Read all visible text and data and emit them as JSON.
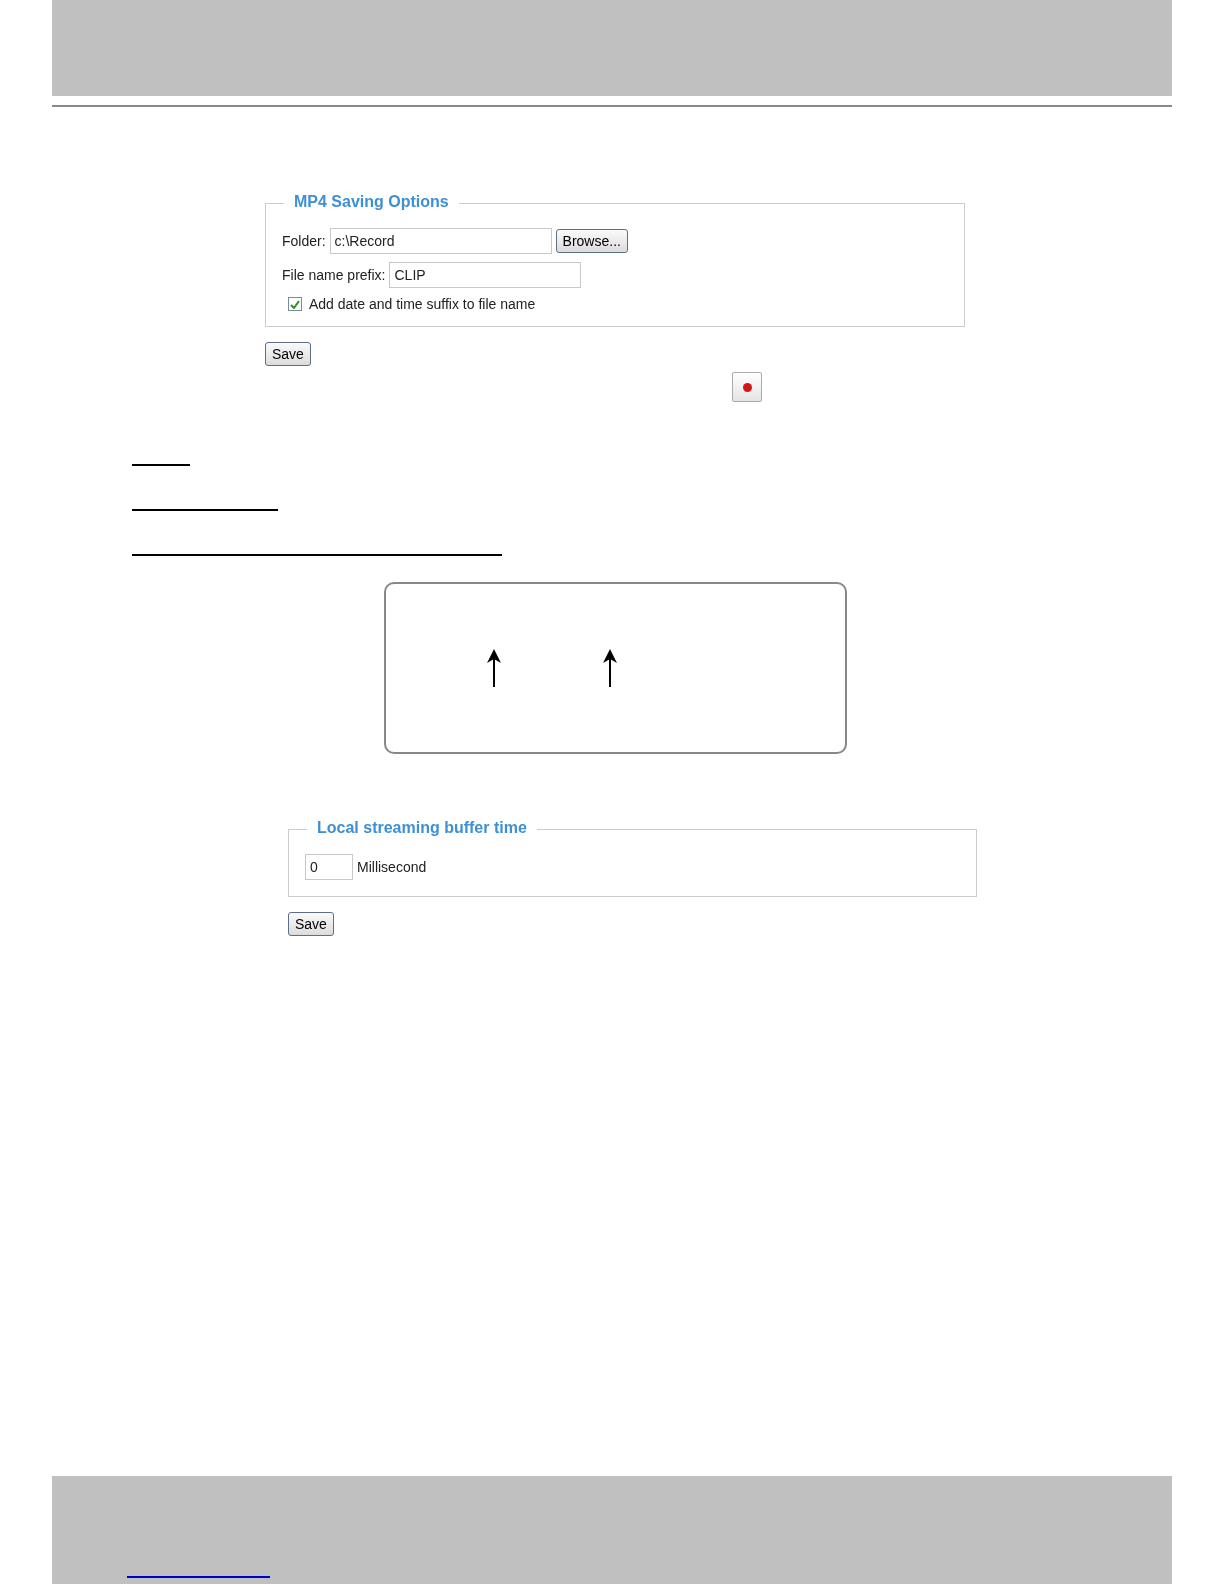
{
  "mp4_options": {
    "title": "MP4 Saving Options",
    "folder_label": "Folder:",
    "folder_value": "c:\\Record",
    "browse_button": "Browse...",
    "prefix_label": "File name prefix:",
    "prefix_value": "CLIP",
    "suffix_checkbox": {
      "label": "Add date and time suffix to file name",
      "checked": true
    },
    "save_button": "Save"
  },
  "buffer_options": {
    "title": "Local streaming buffer time",
    "value": "0",
    "unit": "Millisecond",
    "save_button": "Save"
  }
}
